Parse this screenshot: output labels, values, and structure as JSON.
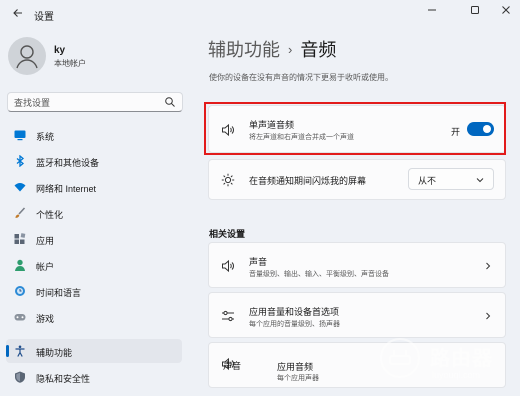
{
  "window": {
    "title": "设置",
    "controls": [
      "minimize",
      "maximize",
      "close"
    ]
  },
  "user": {
    "name": "ky",
    "account_type": "本地帐户"
  },
  "search": {
    "placeholder": "查找设置"
  },
  "sidebar": {
    "items": [
      {
        "label": "系统",
        "icon": "monitor-icon",
        "color": "#0078d4"
      },
      {
        "label": "蓝牙和其他设备",
        "icon": "bluetooth-icon",
        "color": "#0078d4"
      },
      {
        "label": "网络和 Internet",
        "icon": "wifi-icon",
        "color": "#0078d4"
      },
      {
        "label": "个性化",
        "icon": "brush-icon",
        "color": "#c27c2c"
      },
      {
        "label": "应用",
        "icon": "apps-icon",
        "color": "#4a5563"
      },
      {
        "label": "帐户",
        "icon": "person-icon",
        "color": "#2e9d6e"
      },
      {
        "label": "时间和语言",
        "icon": "globe-clock-icon",
        "color": "#0078d4"
      },
      {
        "label": "游戏",
        "icon": "gamepad-icon",
        "color": "#6b7280"
      },
      {
        "label": "辅助功能",
        "icon": "accessibility-icon",
        "color": "#1f4e8c",
        "active": true
      },
      {
        "label": "隐私和安全性",
        "icon": "shield-icon",
        "color": "#4b5563"
      }
    ]
  },
  "main": {
    "breadcrumb_parent": "辅助功能",
    "breadcrumb_current": "音频",
    "description": "使你的设备在没有声音的情况下更易于收听或使用。",
    "mono_audio": {
      "title": "单声道音频",
      "subtitle": "将左声道和右声道合并成一个声道",
      "toggle_label": "开",
      "enabled": true
    },
    "flash_screen": {
      "title": "在音频通知期间闪烁我的屏幕",
      "selected": "从不"
    },
    "related_title": "相关设置",
    "related": [
      {
        "title": "声音",
        "subtitle": "音量级别、输出、输入、平衡级别、声音设备",
        "icon": "speaker-icon"
      },
      {
        "title": "应用音量和设备首选项",
        "subtitle": "每个应用的音量级别、扬声器",
        "icon": "mixer-icon"
      },
      {
        "title": "声音",
        "title2": "应用音频",
        "subtitle": "每个应用声器",
        "icon": "speaker-icon"
      }
    ]
  },
  "watermark": {
    "brand": "路由器",
    "url": "luyouqi.com"
  },
  "colors": {
    "accent": "#0067c0",
    "highlight": "#e21b1b"
  }
}
